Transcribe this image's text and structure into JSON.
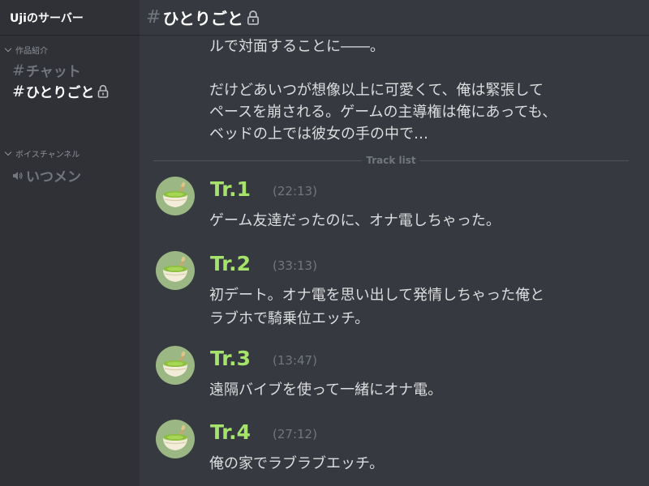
{
  "server": {
    "name": "Ujiのサーバー"
  },
  "sidebar": {
    "categories": [
      {
        "label": "作品紹介",
        "channels": [
          {
            "prefix": "#",
            "name": "チャット",
            "active": false,
            "locked": false
          },
          {
            "prefix": "#",
            "name": "ひとりごと",
            "active": true,
            "locked": true
          }
        ]
      },
      {
        "label": "ボイスチャンネル",
        "channels": [
          {
            "prefix": "speaker-icon",
            "name": "いつメン",
            "active": false,
            "locked": false
          }
        ]
      }
    ]
  },
  "header": {
    "hash": "#",
    "title": "ひとりごと",
    "icon": "lock-icon"
  },
  "description": {
    "line1": "ルで対面することに――。",
    "line2": "だけどあいつが想像以上に可愛くて、俺は緊張して\nペースを崩される。ゲームの主導権は俺にあっても、\nベッドの上では彼女の手の中で…"
  },
  "divider": {
    "label": "Track list"
  },
  "tracks": [
    {
      "title": "Tr.1",
      "time": "(22:13)",
      "desc": "ゲーム友達だったのに、オナ電しちゃった。"
    },
    {
      "title": "Tr.2",
      "time": "(33:13)",
      "desc": "初デート。オナ電を思い出して発情しちゃった俺と\nラブホで騎乗位エッチ。"
    },
    {
      "title": "Tr.3",
      "time": "(13:47)",
      "desc": "遠隔バイブを使って一緒にオナ電。"
    },
    {
      "title": "Tr.4",
      "time": "(27:12)",
      "desc": "俺の家でラブラブエッチ。"
    }
  ],
  "colors": {
    "sidebar_bg": "#2f3136",
    "main_bg": "#36393f",
    "track_title": "#a6e36b",
    "muted": "#72767d",
    "text": "#dcddde",
    "avatar_bg": "#9bb784"
  }
}
